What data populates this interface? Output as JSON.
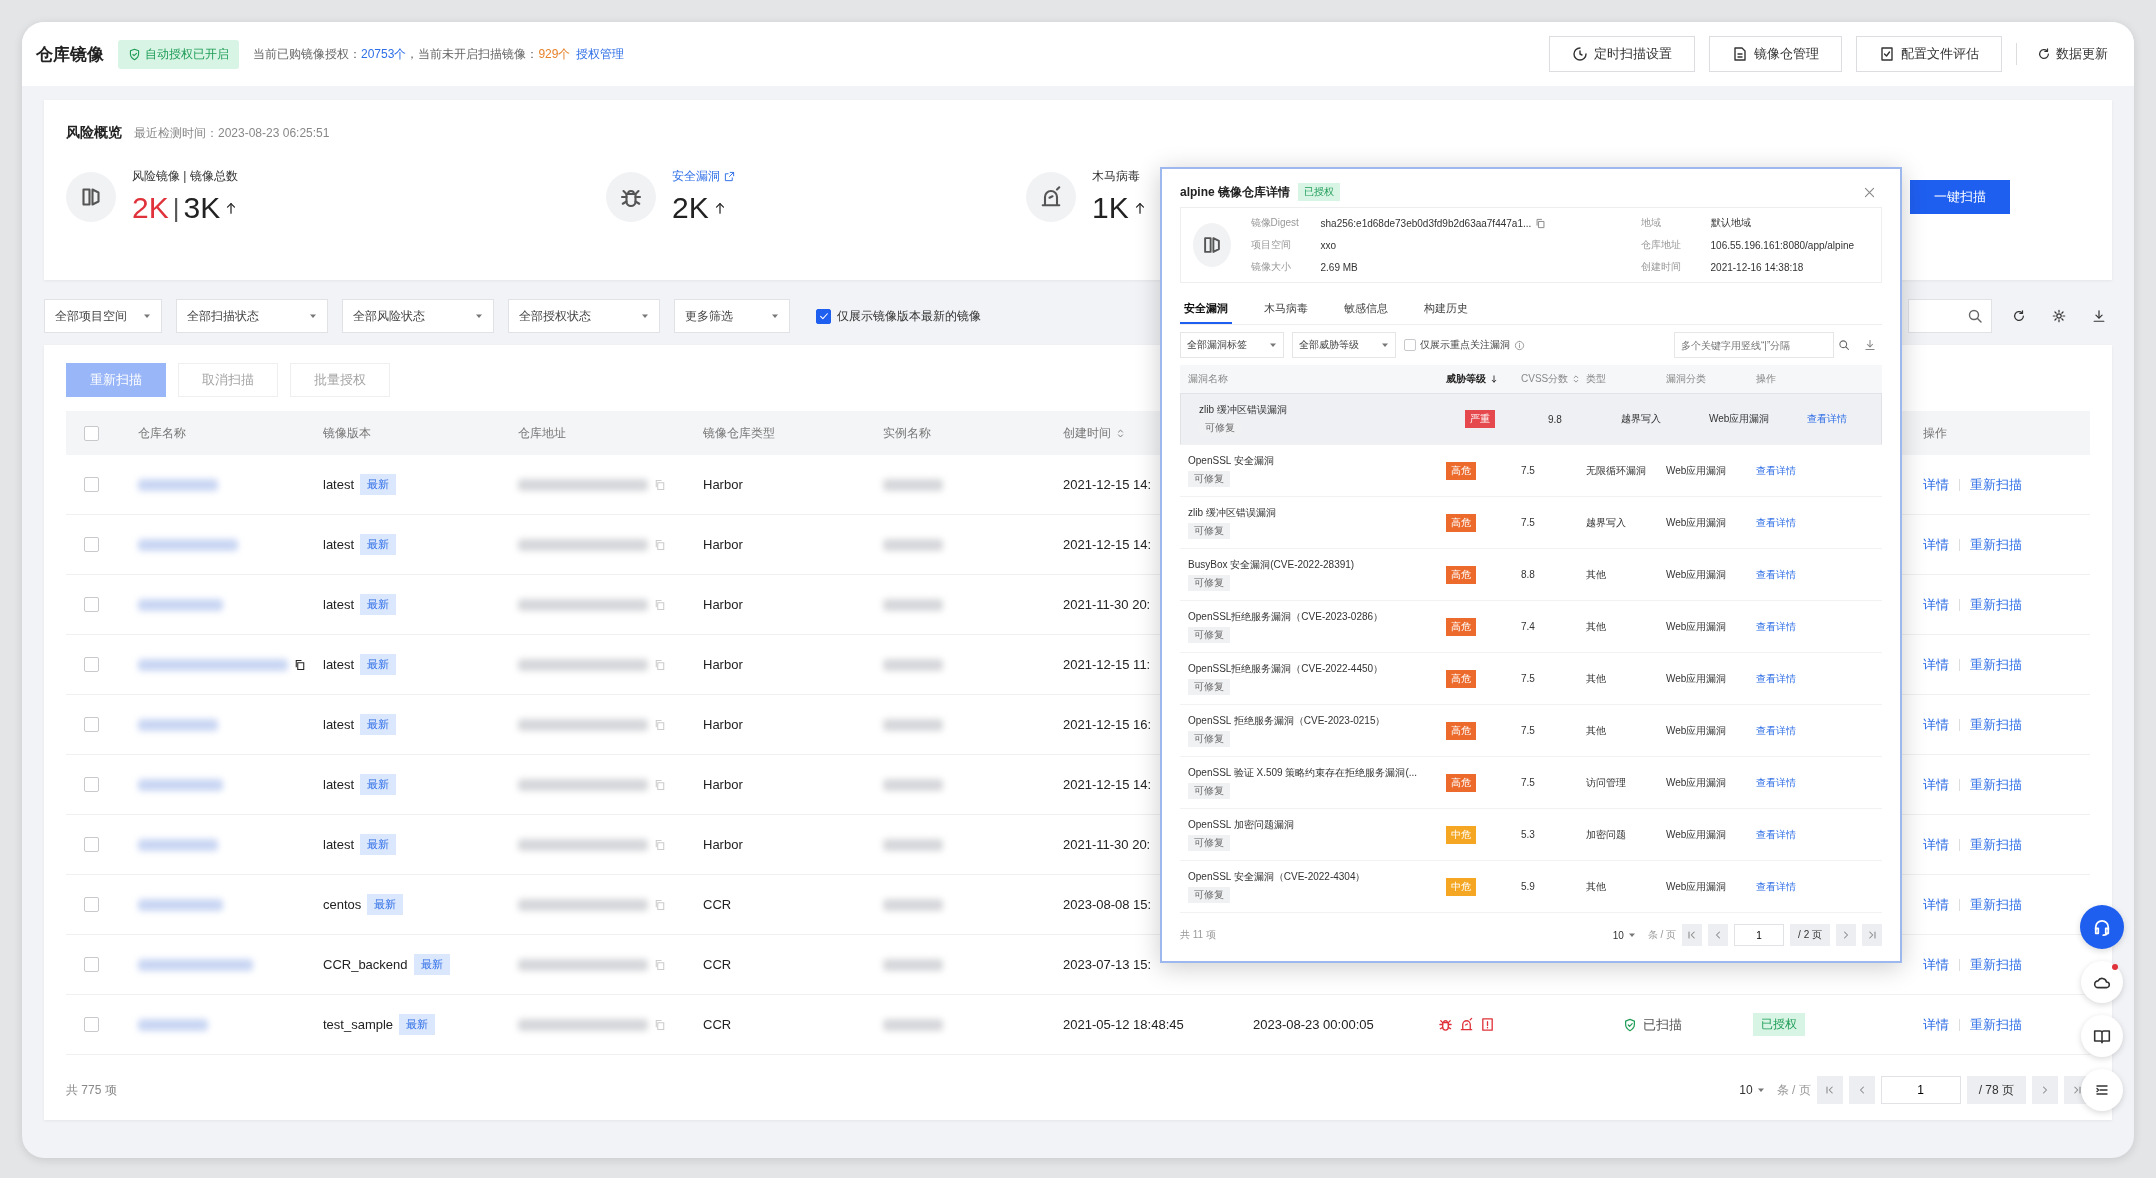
{
  "header": {
    "title": "仓库镜像",
    "badge": "自动授权已开启",
    "info": [
      {
        "kind": "text",
        "text": "当前已购镜像授权："
      },
      {
        "kind": "count",
        "text": "20753个"
      },
      {
        "kind": "text",
        "text": "，当前未开启扫描镜像："
      },
      {
        "kind": "warn",
        "text": "929个"
      },
      {
        "kind": "link",
        "text": "授权管理"
      }
    ],
    "actions": [
      {
        "kind": "timer",
        "label": "定时扫描设置"
      },
      {
        "kind": "repo",
        "label": "镜像仓管理"
      },
      {
        "kind": "checklist",
        "label": "配置文件评估"
      }
    ],
    "refresh": "数据更新"
  },
  "overview": {
    "title": "风险概览",
    "checked_time": "最近检测时间：2023-08-23 06:25:51",
    "stats": [
      {
        "kind": "images",
        "label": "风险镜像 | 镜像总数",
        "link": false,
        "alert": true,
        "value": "2K",
        "separator": "|",
        "total": "3K"
      },
      {
        "kind": "vuln",
        "label": "安全漏洞",
        "link": true,
        "alert": false,
        "value": "2K"
      },
      {
        "kind": "trojan",
        "label": "木马病毒",
        "link": false,
        "alert": false,
        "value": "1K"
      }
    ],
    "scan_button": "一键扫描"
  },
  "filters": {
    "selects": [
      "全部项目空间",
      "全部扫描状态",
      "全部风险状态",
      "全部授权状态",
      "更多筛选"
    ],
    "latest_only": {
      "label": "仅展示镜像版本最新的镜像",
      "checked": true
    }
  },
  "table": {
    "toolbar": [
      {
        "kind": "primary",
        "label": "重新扫描",
        "disabled": true
      },
      {
        "kind": "plain",
        "label": "取消扫描",
        "disabled": true
      },
      {
        "kind": "plain",
        "label": "批量授权",
        "disabled": true
      }
    ],
    "columns": [
      {
        "label": "仓库名称",
        "sortable": false
      },
      {
        "label": "镜像版本",
        "sortable": false
      },
      {
        "label": "仓库地址",
        "sortable": false
      },
      {
        "label": "镜像仓库类型",
        "sortable": false
      },
      {
        "label": "实例名称",
        "sortable": false
      },
      {
        "label": "创建时间",
        "sortable": true
      }
    ],
    "action_column": "操作",
    "all_checked": false,
    "rows": [
      {
        "checked": false,
        "copy_icon": false,
        "version": "latest",
        "tag": "最新",
        "type": "Harbor",
        "created": "2021-12-15 14:",
        "actions": [
          "详情",
          "重新扫描"
        ]
      },
      {
        "checked": false,
        "copy_icon": false,
        "version": "latest",
        "tag": "最新",
        "type": "Harbor",
        "created": "2021-12-15 14:",
        "actions": [
          "详情",
          "重新扫描"
        ]
      },
      {
        "checked": false,
        "copy_icon": false,
        "version": "latest",
        "tag": "最新",
        "type": "Harbor",
        "created": "2021-11-30 20:",
        "actions": [
          "详情",
          "重新扫描"
        ]
      },
      {
        "checked": false,
        "copy_icon": true,
        "version": "latest",
        "tag": "最新",
        "type": "Harbor",
        "created": "2021-12-15 11:",
        "actions": [
          "详情",
          "重新扫描"
        ]
      },
      {
        "checked": false,
        "copy_icon": false,
        "version": "latest",
        "tag": "最新",
        "type": "Harbor",
        "created": "2021-12-15 16:",
        "actions": [
          "详情",
          "重新扫描"
        ]
      },
      {
        "checked": false,
        "copy_icon": false,
        "version": "latest",
        "tag": "最新",
        "type": "Harbor",
        "created": "2021-12-15 14:",
        "actions": [
          "详情",
          "重新扫描"
        ]
      },
      {
        "checked": false,
        "copy_icon": false,
        "version": "latest",
        "tag": "最新",
        "type": "Harbor",
        "created": "2021-11-30 20:",
        "actions": [
          "详情",
          "重新扫描"
        ]
      },
      {
        "checked": false,
        "copy_icon": false,
        "version": "centos",
        "tag": "最新",
        "type": "CCR",
        "created": "2023-08-08 15:",
        "actions": [
          "详情",
          "重新扫描"
        ]
      },
      {
        "checked": false,
        "copy_icon": false,
        "version": "CCR_backend",
        "tag": "最新",
        "type": "CCR",
        "created": "2023-07-13 15:",
        "actions": [
          "详情",
          "重新扫描"
        ]
      },
      {
        "checked": false,
        "copy_icon": false,
        "version": "test_sample",
        "tag": "最新",
        "type": "CCR",
        "created": "2021-05-12 18:48:45",
        "scan_time": "2023-08-23 00:00:05",
        "risks": [
          {
            "kind": "vuln"
          },
          {
            "kind": "trojan"
          },
          {
            "kind": "sensitive"
          }
        ],
        "scan_status": "已扫描",
        "auth_status": "已授权",
        "actions": [
          "详情",
          "重新扫描"
        ]
      }
    ],
    "footer": {
      "total": "共 775 项",
      "page_size": "10",
      "unit": "条 / 页",
      "page": "1",
      "pages": "/ 78 页"
    }
  },
  "detail_modal": {
    "title": "alpine 镜像仓库详情",
    "status": "已授权",
    "fields": [
      {
        "label": "镜像Digest",
        "value": "sha256:e1d68de73eb0d3fd9b2d63aa7f447a1...",
        "copyable": true
      },
      {
        "label": "地域",
        "value": "默认地域",
        "copyable": false
      },
      {
        "label": "项目空间",
        "value": "xxo",
        "copyable": false
      },
      {
        "label": "仓库地址",
        "value": "106.55.196.161:8080/app/alpine",
        "copyable": false
      },
      {
        "label": "镜像大小",
        "value": "2.69 MB",
        "copyable": false
      },
      {
        "label": "创建时间",
        "value": "2021-12-16 14:38:18",
        "copyable": false
      }
    ],
    "tabs": [
      {
        "label": "安全漏洞",
        "selected": true
      },
      {
        "label": "木马病毒",
        "selected": false
      },
      {
        "label": "敏感信息",
        "selected": false
      },
      {
        "label": "构建历史",
        "selected": false
      }
    ],
    "selects": [
      "全部漏洞标签",
      "全部威胁等级"
    ],
    "focus_only": {
      "label": "仅展示重点关注漏洞",
      "checked": false
    },
    "search": {
      "placeholder": "多个关键字用竖线“|”分隔"
    },
    "columns": [
      {
        "label": "漏洞名称",
        "sortable": false,
        "sorted": false
      },
      {
        "label": "威胁等级",
        "sortable": true,
        "sorted": true
      },
      {
        "label": "CVSS分数",
        "sortable": true,
        "sorted": false
      },
      {
        "label": "类型",
        "sortable": false,
        "sorted": false
      },
      {
        "label": "漏洞分类",
        "sortable": false,
        "sorted": false
      },
      {
        "label": "操作",
        "sortable": false,
        "sorted": false
      }
    ],
    "vulns": [
      {
        "name": "zlib 缓冲区错误漏洞",
        "fix": "可修复",
        "level": "严重",
        "color": "#e5484d",
        "score": "9.8",
        "type": "越界写入",
        "category": "Web应用漏洞",
        "action": "查看详情",
        "selected": true
      },
      {
        "name": "OpenSSL 安全漏洞",
        "fix": "可修复",
        "level": "高危",
        "color": "#ec6a2c",
        "score": "7.5",
        "type": "无限循环漏洞",
        "category": "Web应用漏洞",
        "action": "查看详情",
        "selected": false
      },
      {
        "name": "zlib 缓冲区错误漏洞",
        "fix": "可修复",
        "level": "高危",
        "color": "#ec6a2c",
        "score": "7.5",
        "type": "越界写入",
        "category": "Web应用漏洞",
        "action": "查看详情",
        "selected": false
      },
      {
        "name": "BusyBox 安全漏洞(CVE-2022-28391)",
        "fix": "可修复",
        "level": "高危",
        "color": "#ec6a2c",
        "score": "8.8",
        "type": "其他",
        "category": "Web应用漏洞",
        "action": "查看详情",
        "selected": false
      },
      {
        "name": "OpenSSL拒绝服务漏洞（CVE-2023-0286）",
        "fix": "可修复",
        "level": "高危",
        "color": "#ec6a2c",
        "score": "7.4",
        "type": "其他",
        "category": "Web应用漏洞",
        "action": "查看详情",
        "selected": false
      },
      {
        "name": "OpenSSL拒绝服务漏洞（CVE-2022-4450）",
        "fix": "可修复",
        "level": "高危",
        "color": "#ec6a2c",
        "score": "7.5",
        "type": "其他",
        "category": "Web应用漏洞",
        "action": "查看详情",
        "selected": false
      },
      {
        "name": "OpenSSL 拒绝服务漏洞（CVE-2023-0215）",
        "fix": "可修复",
        "level": "高危",
        "color": "#ec6a2c",
        "score": "7.5",
        "type": "其他",
        "category": "Web应用漏洞",
        "action": "查看详情",
        "selected": false
      },
      {
        "name": "OpenSSL 验证 X.509 策略约束存在拒绝服务漏洞(...",
        "fix": "可修复",
        "level": "高危",
        "color": "#ec6a2c",
        "score": "7.5",
        "type": "访问管理",
        "category": "Web应用漏洞",
        "action": "查看详情",
        "selected": false
      },
      {
        "name": "OpenSSL 加密问题漏洞",
        "fix": "可修复",
        "level": "中危",
        "color": "#f5a623",
        "score": "5.3",
        "type": "加密问题",
        "category": "Web应用漏洞",
        "action": "查看详情",
        "selected": false
      },
      {
        "name": "OpenSSL 安全漏洞（CVE-2022-4304）",
        "fix": "可修复",
        "level": "中危",
        "color": "#f5a623",
        "score": "5.9",
        "type": "其他",
        "category": "Web应用漏洞",
        "action": "查看详情",
        "selected": false
      }
    ],
    "footer": {
      "total": "共 11 项",
      "page_size": "10",
      "unit": "条 / 页",
      "page": "1",
      "pages": "/ 2 页"
    }
  }
}
